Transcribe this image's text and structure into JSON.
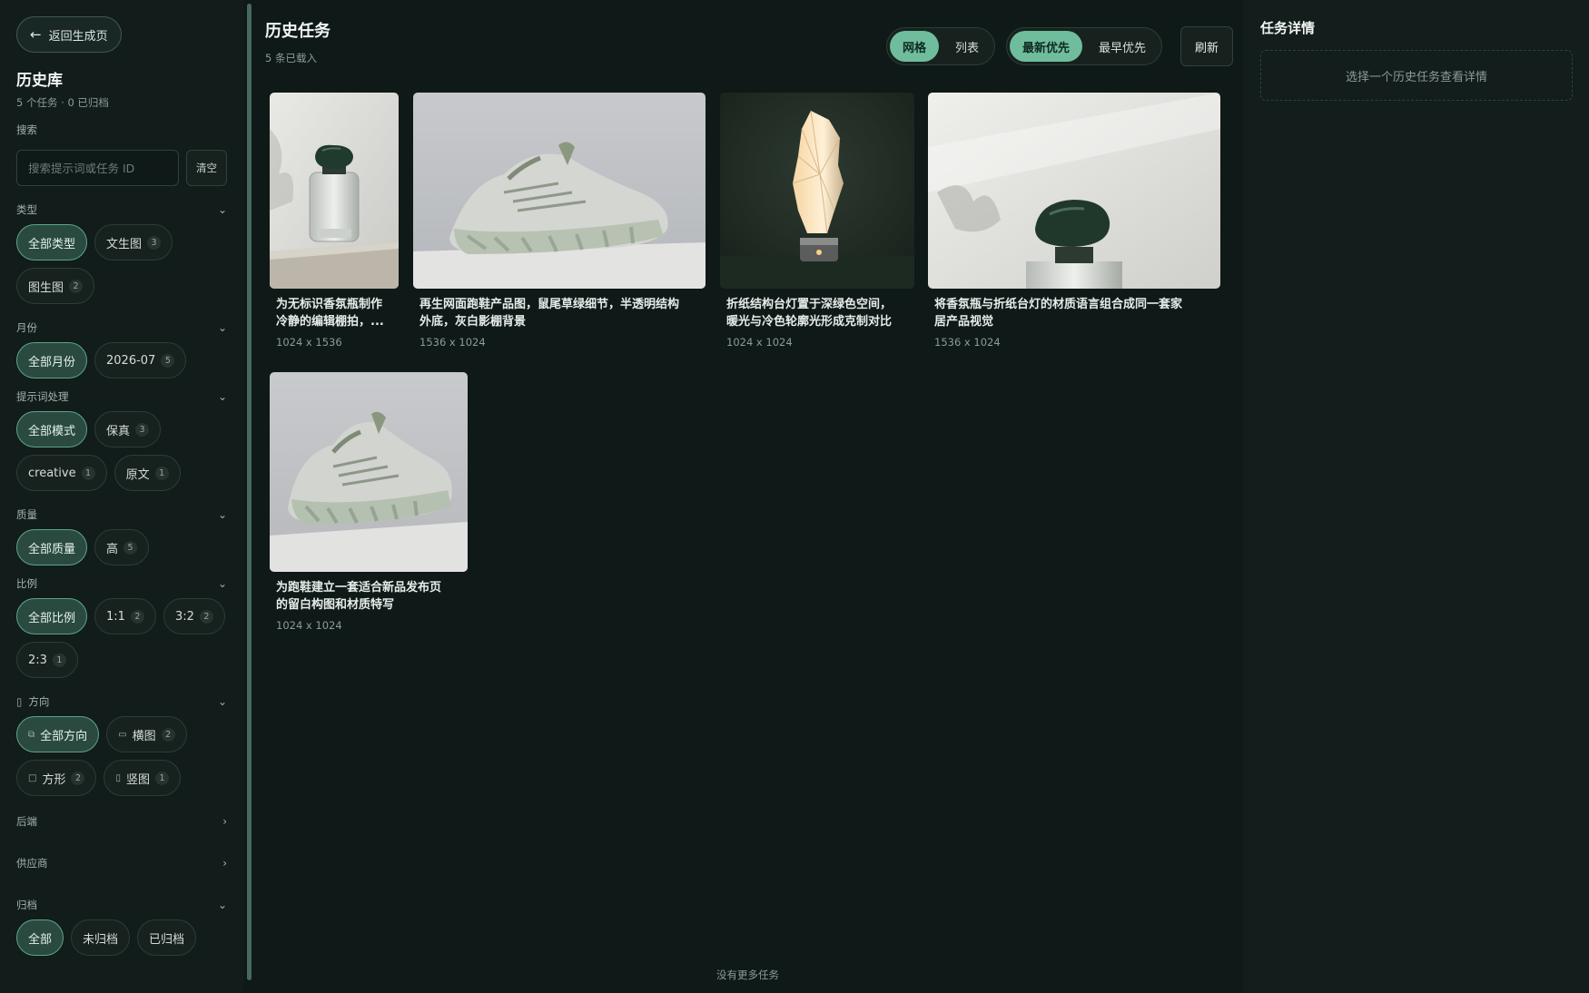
{
  "sidebar": {
    "back_label": "返回生成页",
    "title": "历史库",
    "subtitle": "5 个任务 · 0 已归档",
    "search": {
      "label": "搜索",
      "placeholder": "搜索提示词或任务 ID",
      "value": "",
      "clear_label": "清空"
    },
    "facets": {
      "type": {
        "label": "类型",
        "options": [
          {
            "label": "全部类型",
            "count": "",
            "active": true
          },
          {
            "label": "文生图",
            "count": "3"
          },
          {
            "label": "图生图",
            "count": "2"
          }
        ]
      },
      "month": {
        "label": "月份",
        "options": [
          {
            "label": "全部月份",
            "active": true
          },
          {
            "label": "2026-07",
            "count": "5"
          }
        ]
      },
      "prompt": {
        "label": "提示词处理",
        "options": [
          {
            "label": "全部模式",
            "active": true
          },
          {
            "label": "保真",
            "count": "3"
          },
          {
            "label": "creative",
            "count": "1"
          },
          {
            "label": "原文",
            "count": "1"
          }
        ]
      },
      "quality": {
        "label": "质量",
        "options": [
          {
            "label": "全部质量",
            "active": true
          },
          {
            "label": "高",
            "count": "5"
          }
        ]
      },
      "ratio": {
        "label": "比例",
        "options": [
          {
            "label": "全部比例",
            "active": true
          },
          {
            "label": "1:1",
            "count": "2"
          },
          {
            "label": "3:2",
            "count": "2"
          },
          {
            "label": "2:3",
            "count": "1"
          }
        ]
      },
      "orientation": {
        "label": "方向",
        "options": [
          {
            "label": "全部方向",
            "active": true,
            "icon": "all-orientation-icon"
          },
          {
            "label": "横图",
            "count": "2",
            "icon": "landscape-icon"
          },
          {
            "label": "方形",
            "count": "2",
            "icon": "square-icon"
          },
          {
            "label": "竖图",
            "count": "1",
            "icon": "portrait-icon"
          }
        ]
      },
      "backend": {
        "label": "后端"
      },
      "provider": {
        "label": "供应商"
      },
      "archive": {
        "label": "归档",
        "options": [
          {
            "label": "全部",
            "active": true
          },
          {
            "label": "未归档"
          },
          {
            "label": "已归档"
          }
        ]
      }
    }
  },
  "main": {
    "title": "历史任务",
    "subtitle": "5 条已载入",
    "view_toggle": {
      "grid": "网格",
      "list": "列表",
      "active": "grid"
    },
    "sort_toggle": {
      "newest": "最新优先",
      "oldest": "最早优先",
      "active": "newest"
    },
    "refresh_label": "刷新",
    "tasks": [
      {
        "caption_1": "为无标识香氛瓶制作",
        "caption_2": "冷静的编辑棚拍，...",
        "dims": "1024 x 1536",
        "image": "perfume-bottle-portrait"
      },
      {
        "caption_1": "再生网面跑鞋产品图，鼠尾草绿细节，半透明结构",
        "caption_2": "外底，灰白影棚背景",
        "dims": "1536 x 1024",
        "image": "running-shoe"
      },
      {
        "caption_1": "折纸结构台灯置于深绿色空间，",
        "caption_2": "暖光与冷色轮廓光形成克制对比",
        "dims": "1024 x 1024",
        "image": "origami-lamp"
      },
      {
        "caption_1": "将香氛瓶与折纸台灯的材质语言组合成同一套家",
        "caption_2": "居产品视觉",
        "dims": "1536 x 1024",
        "image": "perfume-bottle-landscape"
      },
      {
        "caption_1": "为跑鞋建立一套适合新品发布页",
        "caption_2": "的留白构图和材质特写",
        "dims": "1024 x 1024",
        "image": "running-shoe-square"
      }
    ],
    "footer": "没有更多任务"
  },
  "detail": {
    "title": "任务详情",
    "empty": "选择一个历史任务查看详情"
  },
  "colors": {
    "accent": "#6fbd9c",
    "active_pill": "#2a4a40",
    "background": "#0f1917"
  }
}
